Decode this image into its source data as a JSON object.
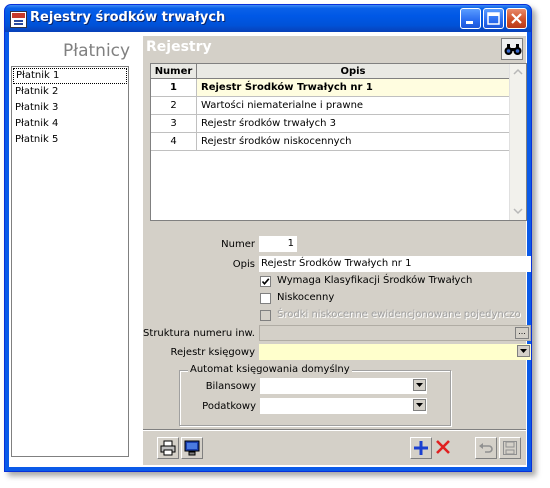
{
  "window": {
    "title": "Rejestry środków trwałych"
  },
  "left": {
    "title": "Płatnicy",
    "items": [
      "Płatnik 1",
      "Płatnik 2",
      "Płatnik 3",
      "Płatnik 4",
      "Płatnik 5"
    ]
  },
  "panel": {
    "title": "Rejestry",
    "grid": {
      "columns": [
        "Numer",
        "Opis"
      ],
      "rows": [
        {
          "numer": "1",
          "opis": "Rejestr Środków Trwałych nr 1"
        },
        {
          "numer": "2",
          "opis": "Wartości niematerialne i prawne"
        },
        {
          "numer": "3",
          "opis": "Rejestr środków trwałych 3"
        },
        {
          "numer": "4",
          "opis": "Rejestr środków niskocennych"
        }
      ]
    },
    "form": {
      "numer_label": "Numer",
      "numer_value": "1",
      "opis_label": "Opis",
      "opis_value": "Rejestr Środków Trwałych nr 1",
      "checkboxes": [
        {
          "label": "Wymaga Klasyfikacji Środków Trwałych",
          "checked": true
        },
        {
          "label": "Niskocenny",
          "checked": false
        },
        {
          "label": "Środki niskocenne ewidencjonowane pojedynczo",
          "checked": false
        }
      ],
      "struktura_label": "Struktura numeru inw.",
      "struktura_button": "...",
      "rejestr_label": "Rejestr księgowy",
      "rejestr_value": "",
      "group_title": "Automat księgowania domyślny",
      "bilansowy_label": "Bilansowy",
      "bilansowy_value": "",
      "podatkowy_label": "Podatkowy",
      "podatkowy_value": ""
    }
  },
  "colors": {
    "titlebar": "#0058e6",
    "panel_bg": "#d4d0c8",
    "selected_row": "#fffde0",
    "required_field": "#ffffcc",
    "add_icon": "#1a3fd0",
    "delete_icon": "#e02020"
  },
  "icons": [
    "app-icon",
    "minimize-icon",
    "maximize-icon",
    "close-icon",
    "binoculars-icon",
    "print-icon",
    "preview-icon",
    "add-icon",
    "delete-icon",
    "undo-icon",
    "save-icon"
  ]
}
